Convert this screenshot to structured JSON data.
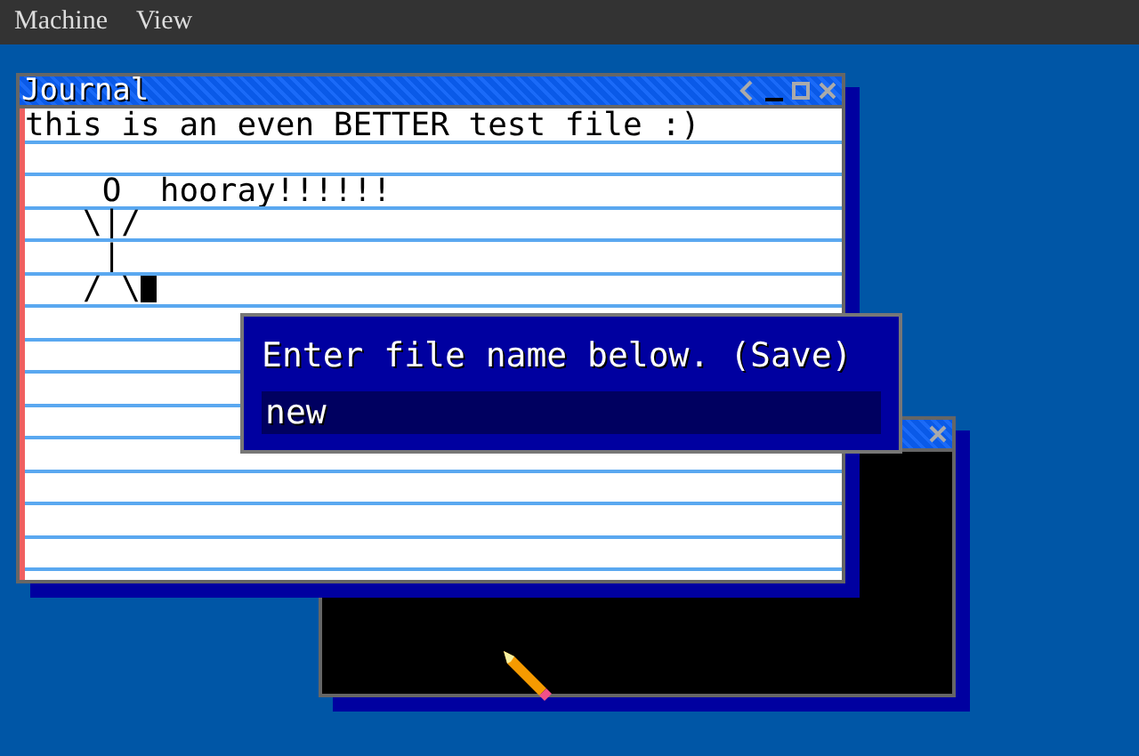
{
  "menu_bar": {
    "items": [
      "Machine",
      "View"
    ]
  },
  "journal_window": {
    "title": "Journal",
    "lines": [
      {
        "text": "this is an even BETTER test file :)",
        "cursor": false
      },
      {
        "cursor": false
      },
      {
        "text": "    O  hooray!!!!!!",
        "cursor": false
      },
      {
        "text": "   \\|/",
        "cursor": false
      },
      {
        "text": "    |",
        "cursor": false
      },
      {
        "text": "   / \\",
        "cursor": true
      }
    ]
  },
  "save_dialog": {
    "prompt": "Enter file name below. (Save)",
    "value": "new"
  }
}
